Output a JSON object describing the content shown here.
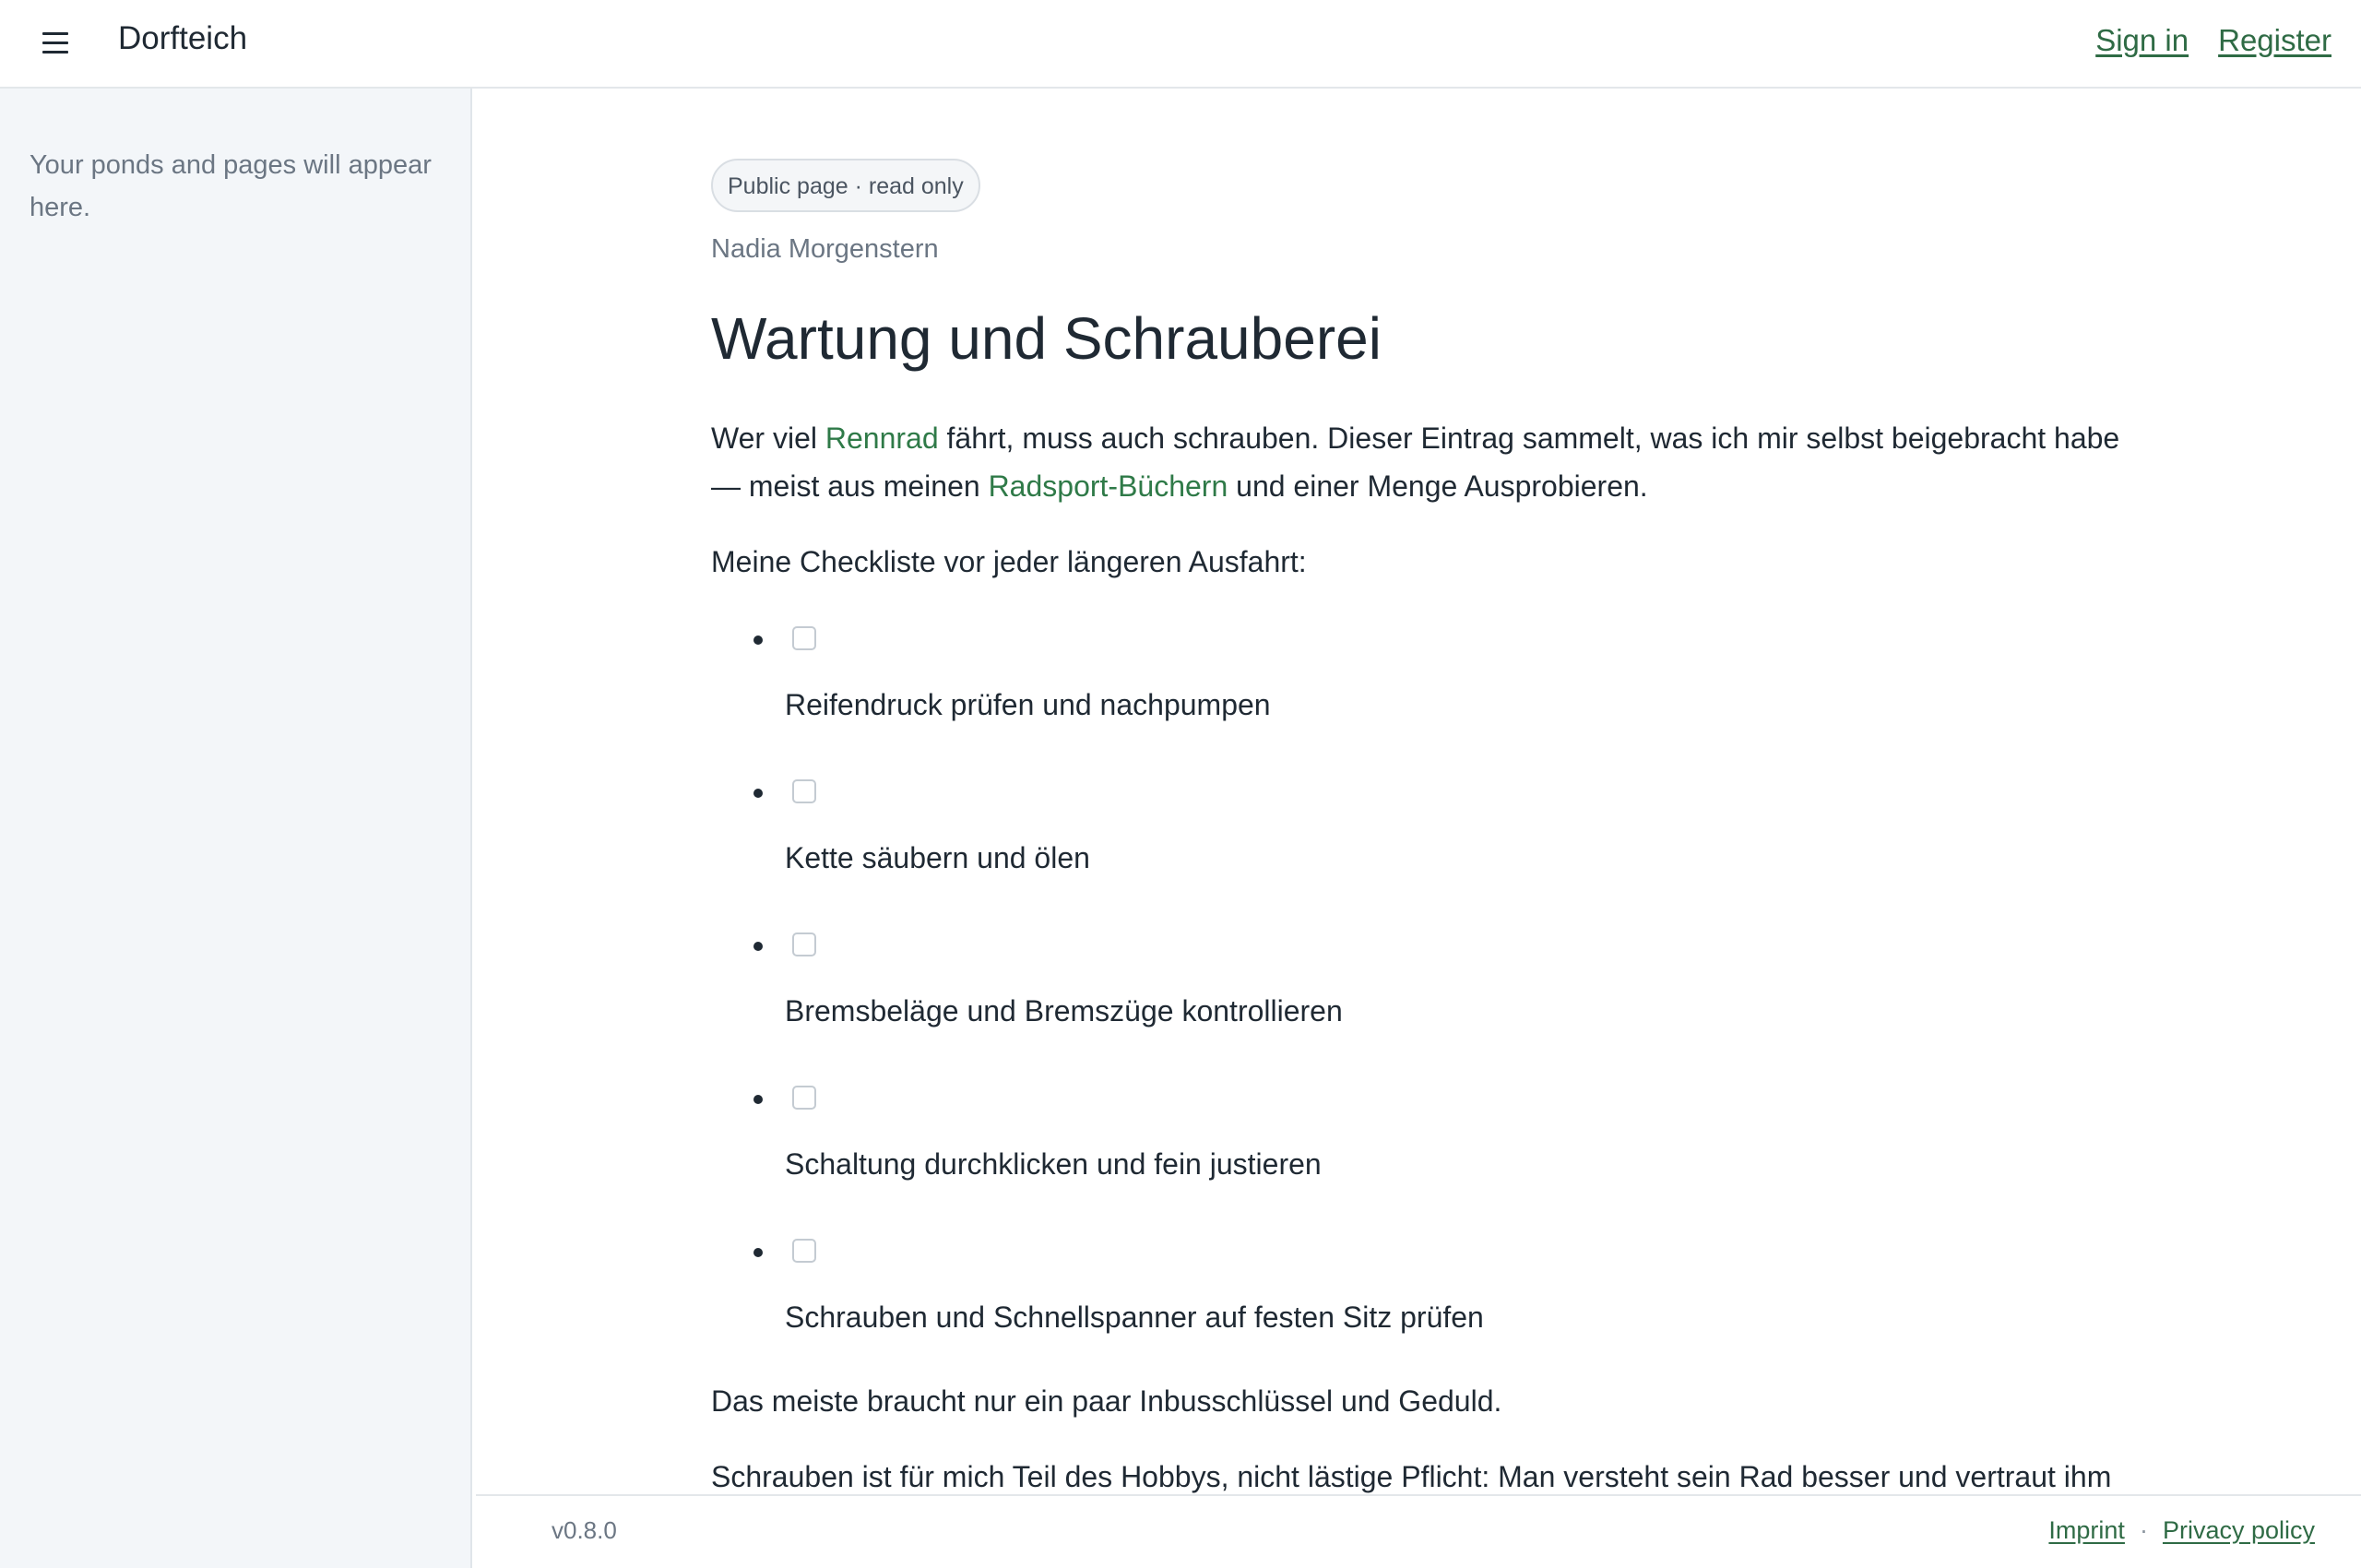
{
  "header": {
    "app_title": "Dorfteich",
    "menu_icon": "hamburger-menu-icon",
    "sign_in": "Sign in",
    "register": "Register"
  },
  "sidebar": {
    "empty_text": "Your ponds and pages will appear here."
  },
  "page": {
    "badge": "Public page · read only",
    "author": "Nadia Morgenstern",
    "title": "Wartung und Schrauberei",
    "intro": {
      "t1": "Wer viel ",
      "link1": "Rennrad",
      "t2": " fährt, muss auch schrauben. Dieser Eintrag sammelt, was ich mir selbst beigebracht habe — meist aus meinen ",
      "link2": "Radsport-Büchern",
      "t3": " und einer Menge Ausprobieren."
    },
    "checklist_intro": "Meine Checkliste vor jeder längeren Ausfahrt:",
    "checklist": [
      {
        "label": "Reifendruck prüfen und nachpumpen",
        "checked": false
      },
      {
        "label": "Kette säubern und ölen",
        "checked": false
      },
      {
        "label": "Bremsbeläge und Bremszüge kontrollieren",
        "checked": false
      },
      {
        "label": "Schaltung durchklicken und fein justieren",
        "checked": false
      },
      {
        "label": "Schrauben und Schnellspanner auf festen Sitz prüfen",
        "checked": false
      }
    ],
    "outro": "Das meiste braucht nur ein paar Inbusschlüssel und Geduld.",
    "cut_paragraph": "Schrauben ist für mich Teil des Hobbys, nicht lästige Pflicht: Man versteht sein Rad besser und vertraut ihm"
  },
  "footer": {
    "version": "v0.8.0",
    "imprint": "Imprint",
    "separator": "·",
    "privacy": "Privacy policy"
  },
  "colors": {
    "accent_link": "#2f6b45",
    "sidebar_bg": "#f3f6f9",
    "text": "#1f2933",
    "muted": "#6b7683"
  }
}
